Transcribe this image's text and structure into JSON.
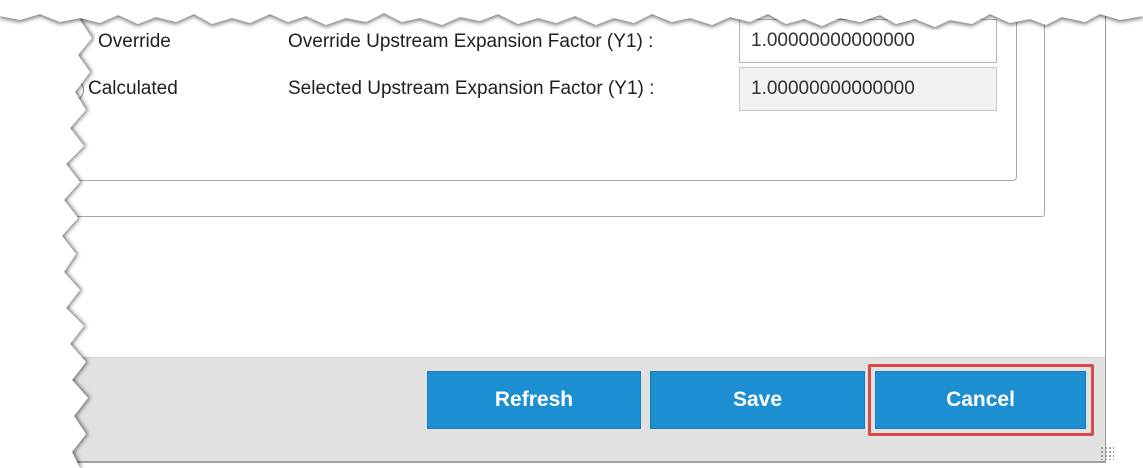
{
  "options": {
    "override": {
      "radio_label": "Override",
      "field_label": "Override Upstream Expansion Factor (Y1) :",
      "field_value": "1.00000000000000"
    },
    "calculated": {
      "radio_label": "Calculated",
      "field_label": "Selected Upstream Expansion Factor (Y1) :",
      "field_value": "1.00000000000000"
    }
  },
  "buttons": {
    "refresh": "Refresh",
    "save": "Save",
    "cancel": "Cancel"
  },
  "colors": {
    "button_blue": "#1b8fd2",
    "footer_gray": "#e1e1e1",
    "highlight_red": "#d9474b"
  }
}
